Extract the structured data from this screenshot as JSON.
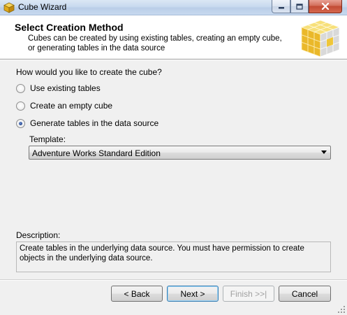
{
  "window": {
    "title": "Cube Wizard",
    "app_icon": "cube-icon",
    "controls": [
      "minimize-icon",
      "maximize-icon",
      "close-icon"
    ]
  },
  "header": {
    "title": "Select Creation Method",
    "description": "Cubes can be created by using existing tables, creating an empty cube, or generating tables in the data source",
    "graphic": "cube-graphic"
  },
  "body": {
    "prompt": "How would you like to create the cube?",
    "options": [
      {
        "label": "Use existing tables",
        "checked": false
      },
      {
        "label": "Create an empty cube",
        "checked": false
      },
      {
        "label": "Generate tables in the data source",
        "checked": true
      }
    ],
    "template": {
      "label": "Template:",
      "selected": "Adventure Works Standard Edition"
    },
    "description": {
      "label": "Description:",
      "text": "Create tables in the underlying data source. You must have permission to create objects in the underlying data source."
    }
  },
  "footer": {
    "back_label": "< Back",
    "next_label": "Next >",
    "finish_label": "Finish >>|",
    "cancel_label": "Cancel"
  },
  "colors": {
    "accent": "#3c7fb1",
    "cube_yellow": "#f2c21b",
    "panel_bg": "#f0f0f0"
  }
}
